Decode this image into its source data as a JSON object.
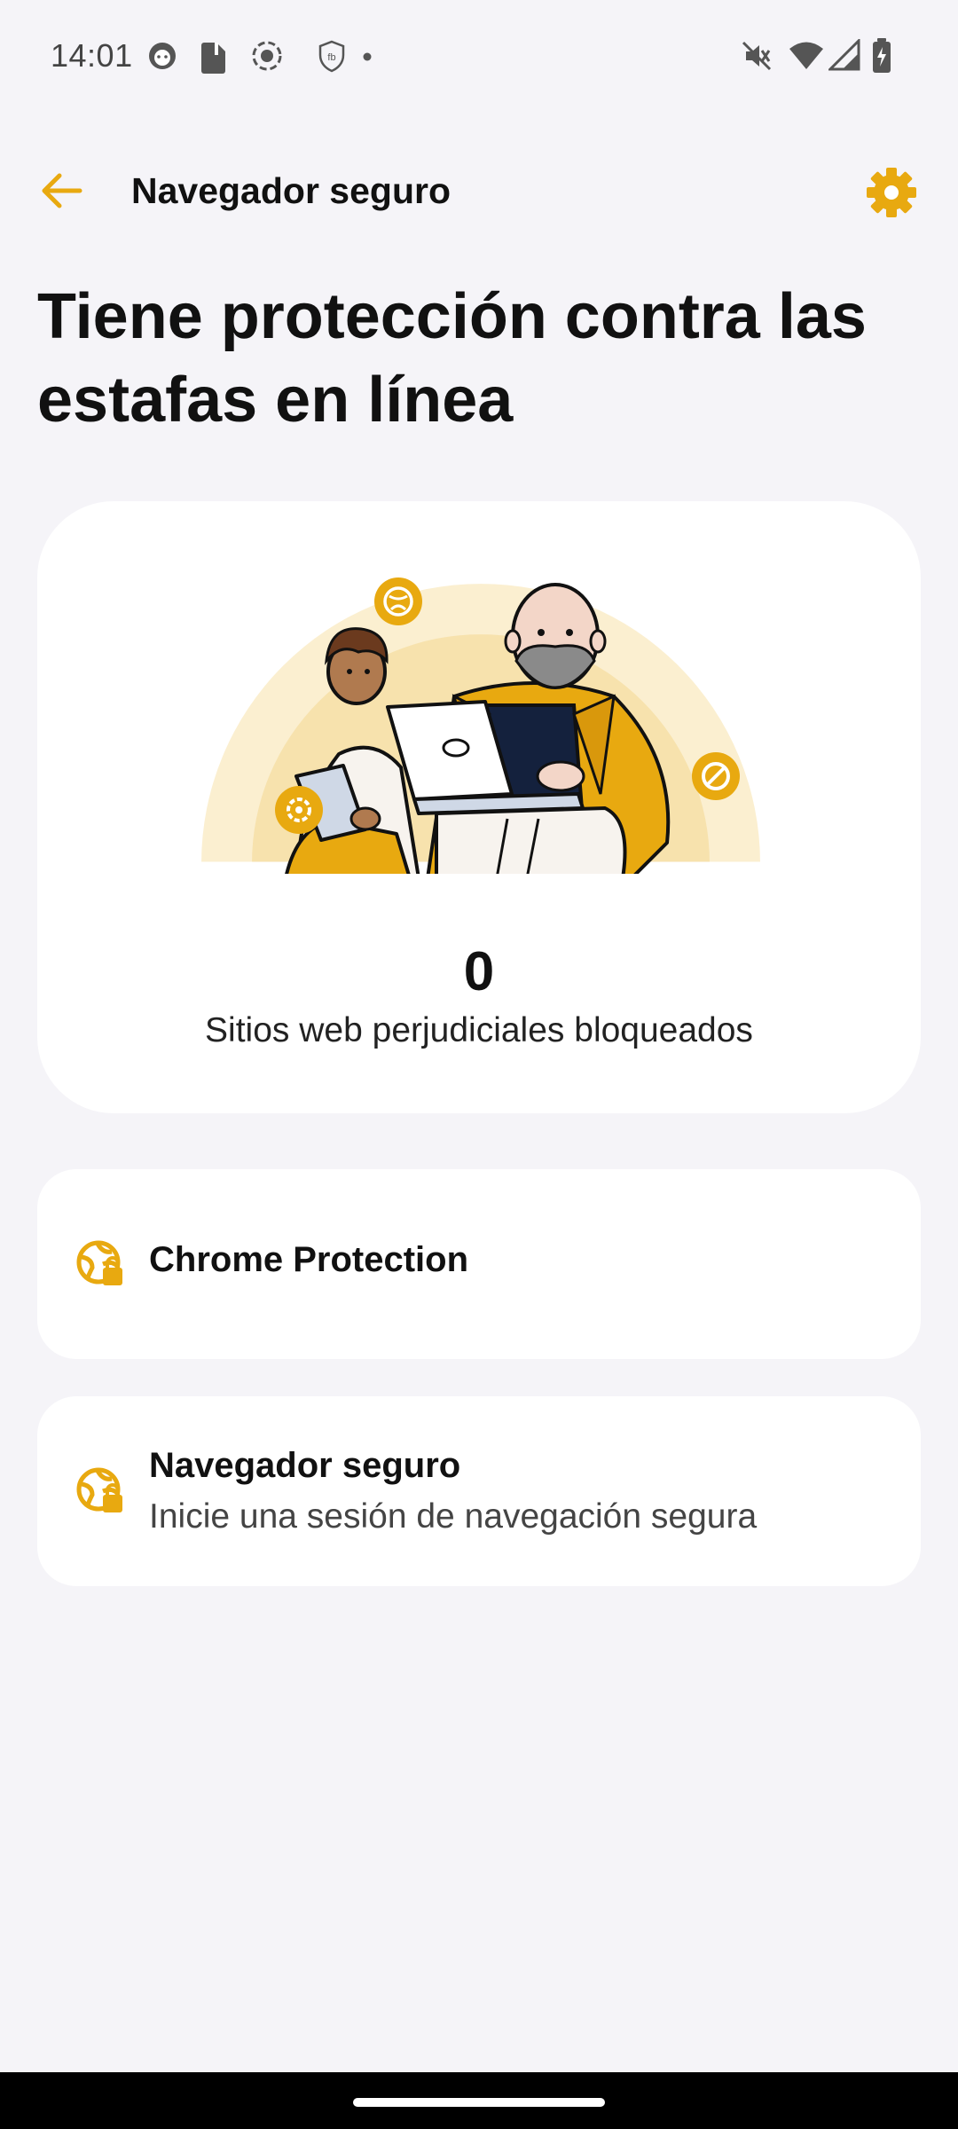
{
  "status_bar": {
    "time": "14:01",
    "left_icons": [
      "cat-face-icon",
      "phone-sim-icon",
      "screen-record-icon",
      "shield-fb-icon",
      "dot-icon"
    ],
    "right_icons": [
      "mute-icon",
      "wifi-icon",
      "signal-icon",
      "battery-charging-icon"
    ]
  },
  "app_bar": {
    "back_icon": "arrow-left-icon",
    "title": "Navegador seguro",
    "settings_icon": "gear-icon"
  },
  "headline": "Tiene protección contra las estafas en línea",
  "hero": {
    "blocked_count": "0",
    "blocked_label": "Sitios web perjudiciales bloqueados"
  },
  "items": [
    {
      "icon": "globe-lock-icon",
      "title": "Chrome Protection"
    },
    {
      "icon": "globe-lock-icon",
      "title": "Navegador seguro",
      "subtitle": "Inicie una sesión de navegación segura"
    }
  ],
  "colors": {
    "accent": "#e8a910",
    "background": "#f5f4f8",
    "card": "#ffffff",
    "text": "#111111"
  }
}
